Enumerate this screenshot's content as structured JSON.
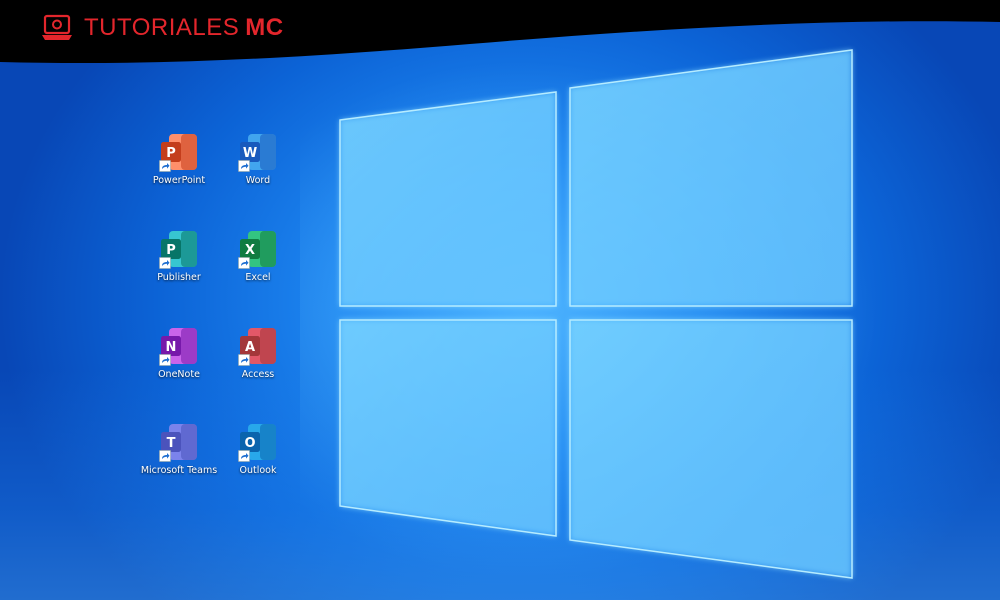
{
  "brand": {
    "name": "TUTORIALES",
    "suffix": "MC",
    "color": "#e3262c"
  },
  "desktop": {
    "icons": [
      {
        "label": "PowerPoint",
        "icon": "powerpoint-icon",
        "letter": "P",
        "color": "#c43e1c",
        "accent": "#ff8f6b"
      },
      {
        "label": "Word",
        "icon": "word-icon",
        "letter": "W",
        "color": "#185abd",
        "accent": "#41a5ee"
      },
      {
        "label": "Publisher",
        "icon": "publisher-icon",
        "letter": "P",
        "color": "#077568",
        "accent": "#37c6d0"
      },
      {
        "label": "Excel",
        "icon": "excel-icon",
        "letter": "X",
        "color": "#107c41",
        "accent": "#33c481"
      },
      {
        "label": "OneNote",
        "icon": "onenote-icon",
        "letter": "N",
        "color": "#7719aa",
        "accent": "#ca64ea"
      },
      {
        "label": "Access",
        "icon": "access-icon",
        "letter": "A",
        "color": "#a4373a",
        "accent": "#e25868"
      },
      {
        "label": "Microsoft Teams",
        "icon": "teams-icon",
        "letter": "T",
        "color": "#4b53bc",
        "accent": "#7b83eb"
      },
      {
        "label": "Outlook",
        "icon": "outlook-icon",
        "letter": "O",
        "color": "#0a64ad",
        "accent": "#28a8ea"
      }
    ]
  }
}
